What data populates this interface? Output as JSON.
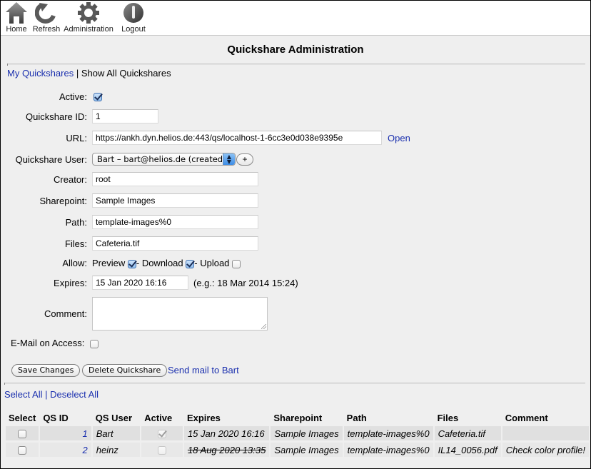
{
  "toolbar": {
    "items": [
      {
        "label": "Home",
        "icon": "home-icon"
      },
      {
        "label": "Refresh",
        "icon": "refresh-icon"
      },
      {
        "label": "Administration",
        "icon": "gear-icon"
      },
      {
        "label": "Logout",
        "icon": "power-icon"
      }
    ]
  },
  "page": {
    "title": "Quickshare Administration"
  },
  "nav": {
    "my_quickshares": "My Quickshares",
    "separator": "|",
    "show_all": "Show All Quickshares"
  },
  "form": {
    "active": {
      "label": "Active:",
      "checked": true
    },
    "quickshare_id": {
      "label": "Quickshare ID:",
      "value": "1"
    },
    "url": {
      "label": "URL:",
      "value": "https://ankh.dyn.helios.de:443/qs/localhost-1-6cc3e0d038e9395e",
      "open_link": "Open"
    },
    "quickshare_user": {
      "label": "Quickshare User:",
      "selected": "Bart – bart@helios.de (created b",
      "add_button": "+"
    },
    "creator": {
      "label": "Creator:",
      "value": "root"
    },
    "sharepoint": {
      "label": "Sharepoint:",
      "value": "Sample Images"
    },
    "path": {
      "label": "Path:",
      "value": "template-images%0"
    },
    "files": {
      "label": "Files:",
      "value": "Cafeteria.tif"
    },
    "allow": {
      "label": "Allow:",
      "preview": {
        "label": "Preview",
        "checked": true
      },
      "download": {
        "label": "- Download",
        "checked": true
      },
      "upload": {
        "label": "- Upload",
        "checked": false
      }
    },
    "expires": {
      "label": "Expires:",
      "value": "15 Jan 2020 16:16",
      "hint": "(e.g.: 18 Mar 2014 15:24)"
    },
    "comment": {
      "label": "Comment:",
      "value": ""
    },
    "email_on_access": {
      "label": "E-Mail on Access:",
      "checked": false
    }
  },
  "actions": {
    "save": "Save Changes",
    "delete": "Delete Quickshare",
    "send_mail": "Send mail to Bart"
  },
  "selection": {
    "select_all": "Select All",
    "separator": "|",
    "deselect_all": "Deselect All"
  },
  "table": {
    "columns": [
      "Select",
      "QS ID",
      "QS User",
      "Active",
      "Expires",
      "Sharepoint",
      "Path",
      "Files",
      "Comment"
    ],
    "rows": [
      {
        "selected": false,
        "id": "1",
        "user": "Bart",
        "active": true,
        "expires": "15 Jan 2020 16:16",
        "expired": false,
        "sharepoint": "Sample Images",
        "path": "template-images%0",
        "files": "Cafeteria.tif",
        "comment": ""
      },
      {
        "selected": false,
        "id": "2",
        "user": "heinz",
        "active": false,
        "expires": "18 Aug 2020 13:35",
        "expired": true,
        "sharepoint": "Sample Images",
        "path": "template-images%0",
        "files": "IL14_0056.pdf",
        "comment": "Check color profile!"
      }
    ]
  }
}
